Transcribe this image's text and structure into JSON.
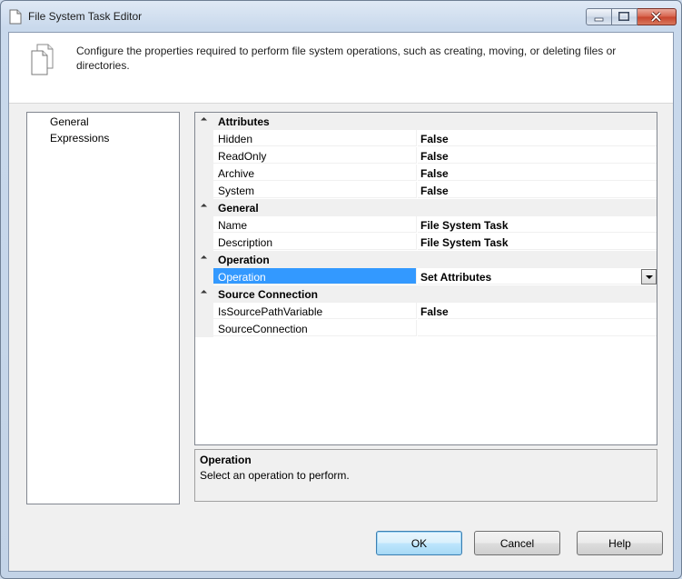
{
  "window": {
    "title": "File System Task Editor"
  },
  "header": {
    "description": "Configure the properties required to perform file system operations, such as creating, moving, or deleting files or directories."
  },
  "nav": {
    "items": [
      "General",
      "Expressions"
    ]
  },
  "grid": {
    "attributes": {
      "label": "Attributes",
      "hidden": {
        "name": "Hidden",
        "value": "False"
      },
      "readonly": {
        "name": "ReadOnly",
        "value": "False"
      },
      "archive": {
        "name": "Archive",
        "value": "False"
      },
      "system": {
        "name": "System",
        "value": "False"
      }
    },
    "general": {
      "label": "General",
      "name": {
        "name": "Name",
        "value": "File System Task"
      },
      "description": {
        "name": "Description",
        "value": "File System Task"
      }
    },
    "operation": {
      "label": "Operation",
      "operation": {
        "name": "Operation",
        "value": "Set Attributes"
      }
    },
    "source": {
      "label": "Source Connection",
      "issourcepathvariable": {
        "name": "IsSourcePathVariable",
        "value": "False"
      },
      "sourceconnection": {
        "name": "SourceConnection",
        "value": ""
      }
    }
  },
  "help": {
    "title": "Operation",
    "description": "Select an operation to perform."
  },
  "buttons": {
    "ok": "OK",
    "cancel": "Cancel",
    "help": "Help"
  },
  "colors": {
    "selection": "#3399ff",
    "category_bg": "#f0f0f0",
    "title_bar": "#c9d9ec"
  }
}
